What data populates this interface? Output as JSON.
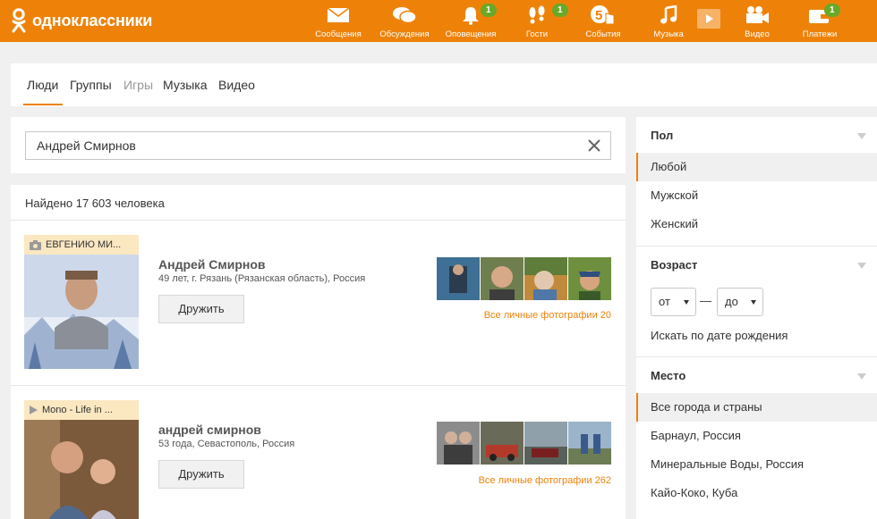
{
  "brand": {
    "name": "одноклассники",
    "accent": "#ee8208",
    "badge_color": "#6aa828"
  },
  "nav": [
    {
      "label": "Сообщения",
      "icon": "envelope-icon",
      "badge": ""
    },
    {
      "label": "Обсуждения",
      "icon": "chat-bubbles-icon",
      "badge": ""
    },
    {
      "label": "Оповещения",
      "icon": "bell-icon",
      "badge": "1"
    },
    {
      "label": "Гости",
      "icon": "footprints-icon",
      "badge": "1"
    },
    {
      "label": "События",
      "icon": "five-hand-icon",
      "badge": ""
    },
    {
      "label": "Музыка",
      "icon": "music-note-icon",
      "badge": ""
    },
    {
      "label": "Видео",
      "icon": "video-camera-icon",
      "badge": ""
    },
    {
      "label": "Платежи",
      "icon": "wallet-icon",
      "badge": "1"
    }
  ],
  "tabs": [
    {
      "label": "Люди",
      "active": true
    },
    {
      "label": "Группы"
    },
    {
      "label": "Игры",
      "disabled": true
    },
    {
      "label": "Музыка"
    },
    {
      "label": "Видео"
    }
  ],
  "search": {
    "value": "Андрей Смирнов"
  },
  "results": {
    "found_text": "Найдено 17 603 человека",
    "people": [
      {
        "caption": "ЕВГЕНИЮ МИ...",
        "caption_icon": "camera-icon",
        "name": "Андрей Смирнов",
        "meta": "49 лет, г. Рязань (Рязанская область), Россия",
        "button": "Дружить",
        "all_photos": "Все личные фотографии 20"
      },
      {
        "caption": "Mono - Life in ...",
        "caption_icon": "play-icon",
        "name": "андрей смирнов",
        "meta": "53 года, Севастополь, Россия",
        "button": "Дружить",
        "all_photos": "Все личные фотографии 262"
      }
    ]
  },
  "filters": {
    "gender": {
      "title": "Пол",
      "options": [
        "Любой",
        "Мужской",
        "Женский"
      ],
      "selected": "Любой"
    },
    "age": {
      "title": "Возраст",
      "from": "от",
      "dash": "—",
      "to": "до",
      "birthdate_link": "Искать по дате рождения"
    },
    "place": {
      "title": "Место",
      "options": [
        "Все города и страны",
        "Барнаул, Россия",
        "Минеральные Воды, Россия",
        "Кайо-Коко, Куба"
      ],
      "selected": "Все города и страны"
    }
  }
}
